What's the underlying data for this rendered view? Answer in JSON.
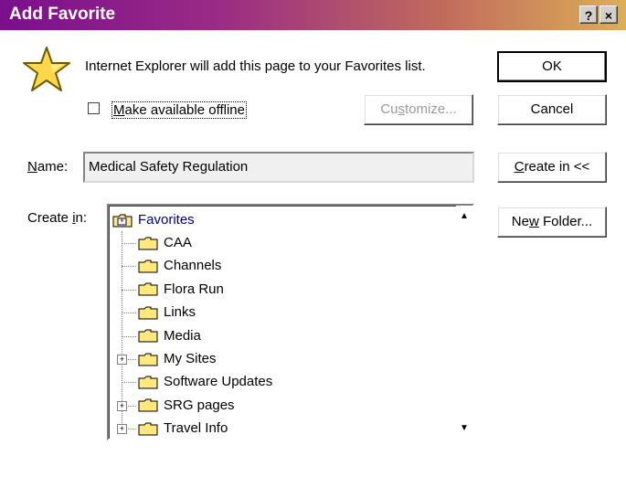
{
  "window": {
    "title": "Add Favorite",
    "help_label": "?",
    "close_label": "×"
  },
  "message": "Internet Explorer will add this page to your Favorites list.",
  "offline": {
    "label_pre": "",
    "label_u": "M",
    "label_post": "ake available offline",
    "checked": false
  },
  "buttons": {
    "ok": "OK",
    "cancel": "Cancel",
    "customize_pre": "Cu",
    "customize_u": "s",
    "customize_post": "tomize...",
    "create_in_u": "C",
    "create_in_post": "reate in <<",
    "new_folder_pre": "Ne",
    "new_folder_u": "w",
    "new_folder_post": " Folder..."
  },
  "name_field": {
    "label_u": "N",
    "label_post": "ame:",
    "value": "Medical  Safety Regulation"
  },
  "create_in": {
    "label_pre": "Create ",
    "label_u": "i",
    "label_post": "n:"
  },
  "tree": {
    "root": "Favorites",
    "items": [
      {
        "label": "CAA",
        "expandable": false
      },
      {
        "label": "Channels",
        "expandable": false
      },
      {
        "label": "Flora Run",
        "expandable": false
      },
      {
        "label": "Links",
        "expandable": false
      },
      {
        "label": "Media",
        "expandable": false
      },
      {
        "label": "My Sites",
        "expandable": true
      },
      {
        "label": "Software Updates",
        "expandable": false
      },
      {
        "label": "SRG pages",
        "expandable": true
      },
      {
        "label": "Travel Info",
        "expandable": true
      }
    ]
  },
  "colors": {
    "title_gradient_start": "#7a0f8c",
    "title_gradient_end": "#dcae57",
    "folder_yellow": "#ffe87c",
    "root_text": "#000080"
  }
}
